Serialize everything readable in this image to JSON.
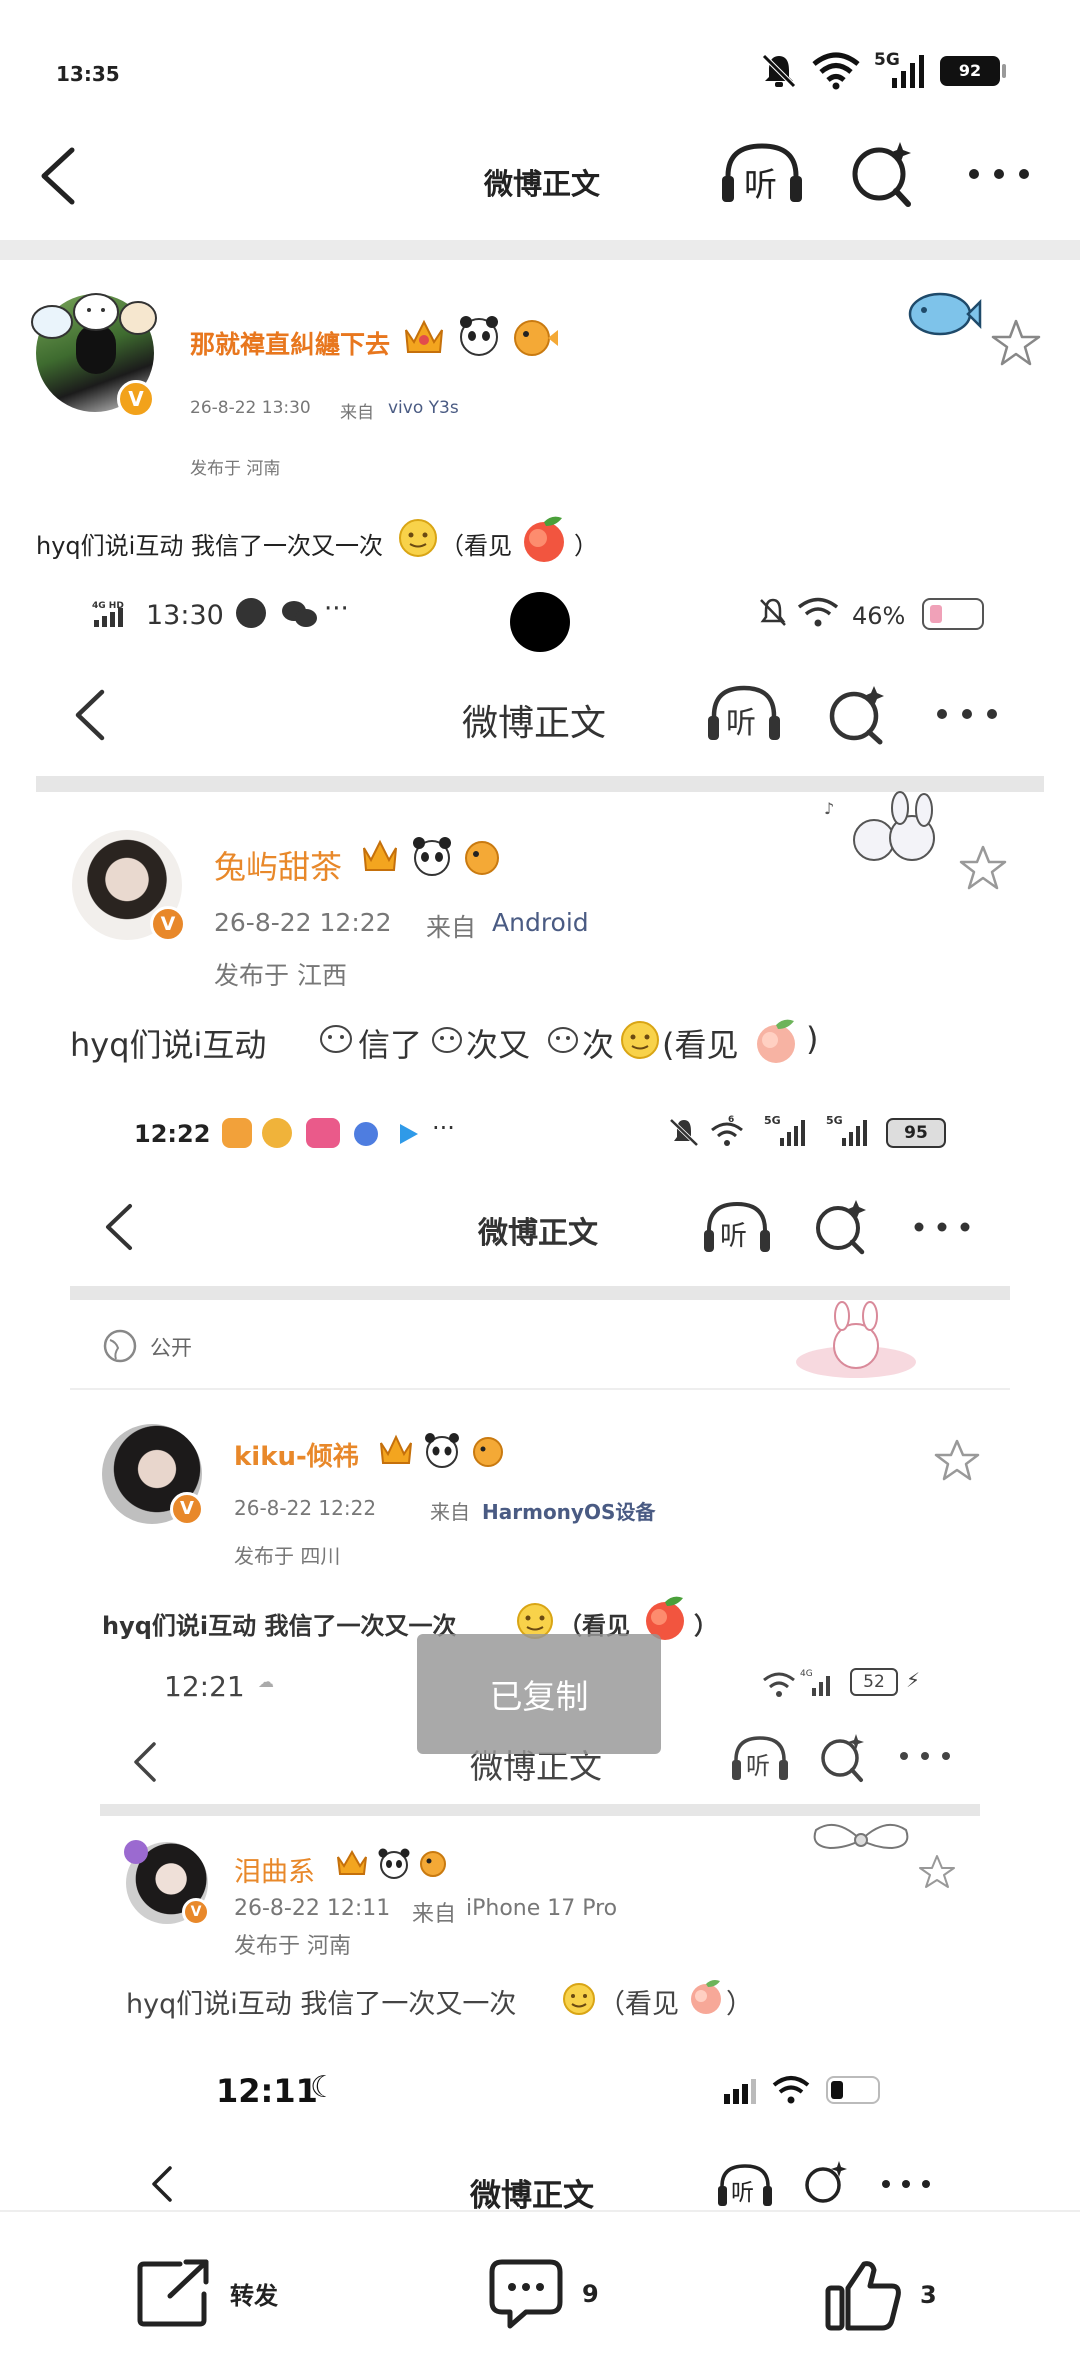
{
  "status_bar": {
    "time": "13:35",
    "network": "5G",
    "battery": "92"
  },
  "header": {
    "title": "微博正文",
    "listen_label": "听"
  },
  "post": {
    "username": "那就禕直糾纏下去",
    "time": "26-8-22 13:30",
    "source_prefix": "来自",
    "source": "vivo Y3s",
    "location": "发布于 河南",
    "text_a": "hyq们说i互动 我信了一次又一次",
    "text_b": "（看见",
    "text_c": "）"
  },
  "shot1": {
    "status_time": "13:30",
    "status_net": "4G HD",
    "battery": "46%",
    "title": "微博正文",
    "listen_label": "听",
    "username": "兔屿甜茶",
    "time": "26-8-22 12:22",
    "source_prefix": "来自",
    "source": "Android",
    "location": "发布于 江西",
    "text_a": "hyq们说i互动",
    "text_b": "信了",
    "text_c": "次又",
    "text_d": "次",
    "text_e": "(看见",
    "text_f": ")"
  },
  "shot2": {
    "status_time": "12:22",
    "battery": "95",
    "title": "微博正文",
    "listen_label": "听",
    "visibility": "公开",
    "username": "kiku-倾祎",
    "time": "26-8-22 12:22",
    "source_prefix": "来自",
    "source": "HarmonyOS设备",
    "location": "发布于 四川",
    "text_a": "hyq们说i互动 我信了一次又一次",
    "text_b": "（看见",
    "text_c": "）"
  },
  "shot3": {
    "status_time": "12:21",
    "battery": "52",
    "title": "微博正文",
    "listen_label": "听",
    "username": "泪曲系",
    "time": "26-8-22 12:11",
    "source_prefix": "来自",
    "source": "iPhone 17 Pro",
    "location": "发布于 河南",
    "text_a": "hyq们说i互动 我信了一次又一次",
    "text_b": "（看见",
    "text_c": "）"
  },
  "shot4": {
    "status_time": "12:11",
    "title": "微博正文",
    "listen_label": "听"
  },
  "toast": {
    "text": "已复制"
  },
  "bottom": {
    "repost_label": "转发",
    "comment_count": "9",
    "like_count": "3"
  },
  "colors": {
    "orange": "#e8771e",
    "source_blue": "#4a5b83",
    "badge": "#f2a21b"
  }
}
